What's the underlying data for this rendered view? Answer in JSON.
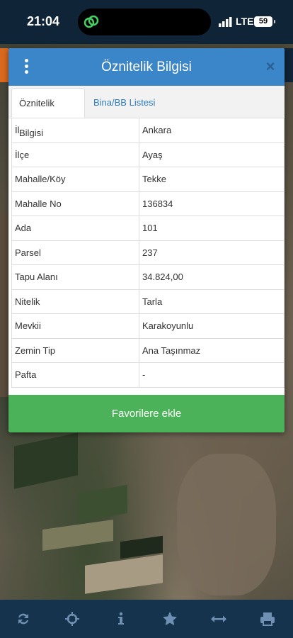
{
  "status_bar": {
    "time": "21:04",
    "network": "LTE",
    "battery": "59"
  },
  "modal": {
    "title": "Öznitelik Bilgisi",
    "close_label": "×",
    "tabs": [
      {
        "label": "Öznitelik Bilgisi"
      },
      {
        "label": "Bina/BB Listesi"
      }
    ],
    "rows": [
      {
        "key": "İl",
        "value": "Ankara"
      },
      {
        "key": "İlçe",
        "value": "Ayaş"
      },
      {
        "key": "Mahalle/Köy",
        "value": "Tekke"
      },
      {
        "key": "Mahalle No",
        "value": "136834"
      },
      {
        "key": "Ada",
        "value": "101"
      },
      {
        "key": "Parsel",
        "value": "237"
      },
      {
        "key": "Tapu Alanı",
        "value": "34.824,00"
      },
      {
        "key": "Nitelik",
        "value": "Tarla"
      },
      {
        "key": "Mevkii",
        "value": "Karakoyunlu"
      },
      {
        "key": "Zemin Tip",
        "value": "Ana Taşınmaz"
      },
      {
        "key": "Pafta",
        "value": "-"
      }
    ],
    "favorite_button": "Favorilere ekle"
  },
  "toolbar": {
    "icons": [
      "refresh-icon",
      "crosshair-icon",
      "info-icon",
      "star-icon",
      "measure-icon",
      "print-icon"
    ]
  },
  "colors": {
    "header": "#3a86c9",
    "favorite_button": "#4cb25a",
    "toolbar": "#16334e",
    "tab_link": "#2f7cc0"
  }
}
